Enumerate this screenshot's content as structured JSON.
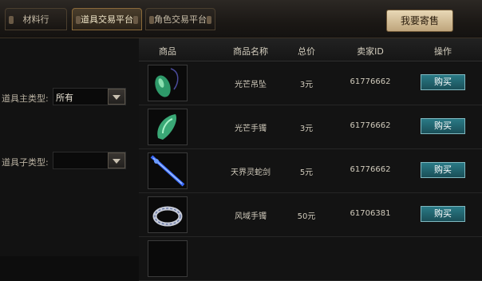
{
  "tabs": [
    {
      "label": "材料行",
      "active": false
    },
    {
      "label": "道具交易平台",
      "active": true
    },
    {
      "label": "角色交易平台",
      "active": false
    }
  ],
  "sell_button": "我要寄售",
  "filters": {
    "main_type_label": "道具主类型:",
    "main_type_value": "所有",
    "sub_type_label": "道具子类型:",
    "sub_type_value": ""
  },
  "table": {
    "headers": [
      "商品",
      "商品名称",
      "总价",
      "卖家ID",
      "操作"
    ],
    "rows": [
      {
        "icon": "jade-pendant-icon",
        "name": "光芒吊坠",
        "price": "3元",
        "seller": "61776662",
        "action": "购买"
      },
      {
        "icon": "jade-bracelet-icon",
        "name": "光芒手镯",
        "price": "3元",
        "seller": "61776662",
        "action": "购买"
      },
      {
        "icon": "blue-sword-icon",
        "name": "天界灵蛇剑",
        "price": "5元",
        "seller": "61776662",
        "action": "购买"
      },
      {
        "icon": "silver-bracelet-icon",
        "name": "风域手镯",
        "price": "50元",
        "seller": "61706381",
        "action": "购买"
      }
    ]
  },
  "colors": {
    "buy_button": "#2a7a86",
    "active_tab_border": "#8a6a3a",
    "sell_button": "#e8d8b6"
  }
}
